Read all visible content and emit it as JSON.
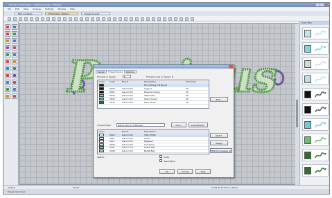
{
  "window": {
    "title": "Premier+ Embroidery - Lettering Design - Threads"
  },
  "menu": [
    "File",
    "Edit",
    "View",
    "Arrange",
    "Settings",
    "Window",
    "Help"
  ],
  "mode_tabs": [
    {
      "label": "Mini Contents",
      "active": false
    },
    {
      "label": "Embroidery Options",
      "active": true
    },
    {
      "label": "Design Layout",
      "active": false
    }
  ],
  "design": {
    "word": "Precious",
    "thread_color": "#4f9a44",
    "fill_color": "#cfe0c7",
    "ornament_color": "#6f55a3"
  },
  "dialog": {
    "tabs": [
      {
        "label": "Design",
        "active": false
      },
      {
        "label": "Thread Colors",
        "active": true
      },
      {
        "label": "Options",
        "active": false
      }
    ],
    "threads_in_design_label": "Threads in design:",
    "threads_in_design_value": "8",
    "threads_used_label": "Threads used in design: 8",
    "table_headers": [
      "Color",
      "Code",
      "Brand",
      "Description",
      "Thickness"
    ],
    "table_rows": [
      {
        "color": "#1b1b1b",
        "code": "",
        "brand": "",
        "description": "Fill Clothing, Fill Blond",
        "thickness": ""
      },
      {
        "color": "#111111",
        "code": "0020",
        "brand": "Isacord 40",
        "description": "Laguna",
        "thickness": "40"
      },
      {
        "color": "#111111",
        "code": "0022",
        "brand": "Isacord 40",
        "description": "Pavement Grey",
        "thickness": "40"
      },
      {
        "color": "#66d8e0",
        "code": "0043",
        "brand": "Isacord 40",
        "description": "Silhouette",
        "thickness": "40"
      },
      {
        "color": "#36a9d6",
        "code": "3840",
        "brand": "Isacord 40",
        "description": "Island Green",
        "thickness": "40"
      },
      {
        "color": "#2f6f2d",
        "code": "5633",
        "brand": "Isacord 40",
        "description": "Dark Green",
        "thickness": "40"
      }
    ],
    "edit_button": "Edit...",
    "thread_chart_label": "Thread Chart:",
    "thread_chart_value": "Isacord 40 (or mixtures)",
    "find_button": "Find...",
    "load_button": "Load/Modify...",
    "lower_headers": [
      "Color",
      "Brand",
      "Description"
    ],
    "lower_rows": [
      {
        "color": "#ffffff",
        "code": "0010",
        "brand": "Isacord 40",
        "description": "Silky White",
        "sel": true
      },
      {
        "color": "#c7eef2",
        "code": "0015",
        "brand": "Isacord 40",
        "description": "Snow",
        "sel": false
      },
      {
        "color": "#e6f5ea",
        "code": "0017",
        "brand": "Isacord 40",
        "description": "Eggshell",
        "sel": false
      },
      {
        "color": "#a9e3d6",
        "code": "0020",
        "brand": "Isacord 40",
        "description": "Cinnamon",
        "sel": false
      },
      {
        "color": "#6fc8c2",
        "code": "0101",
        "brand": "Isacord 40",
        "description": "Shark Teal",
        "sel": false
      },
      {
        "color": "#b9bfc7",
        "code": "0108",
        "brand": "Isacord 40",
        "description": "Ballet Bleu",
        "sel": false
      }
    ],
    "search_label": "Search:",
    "code_label": "Code",
    "description_check": "Description",
    "match_button": "Match",
    "assign_button": "Assign",
    "apply_button": "Match to Design All",
    "ok_button": "OK",
    "cancel_button": "Cancel",
    "help_button": "Help"
  },
  "right_panel": {
    "title": "Color Film",
    "swatches": [
      "#b9e7ec",
      "#7ed7e4",
      "#cfd8dd",
      "#b7e1ea",
      "#111111",
      "#111111",
      "#6ccfd8",
      "#6bbf6a",
      "#2f6f2d",
      "#2f6f2d"
    ]
  },
  "statusbar": {
    "left": "Vertical",
    "center": "Ready",
    "right": "5,345 St  127mm x 44mm"
  },
  "bottombar": {
    "left": "Design Overview"
  }
}
